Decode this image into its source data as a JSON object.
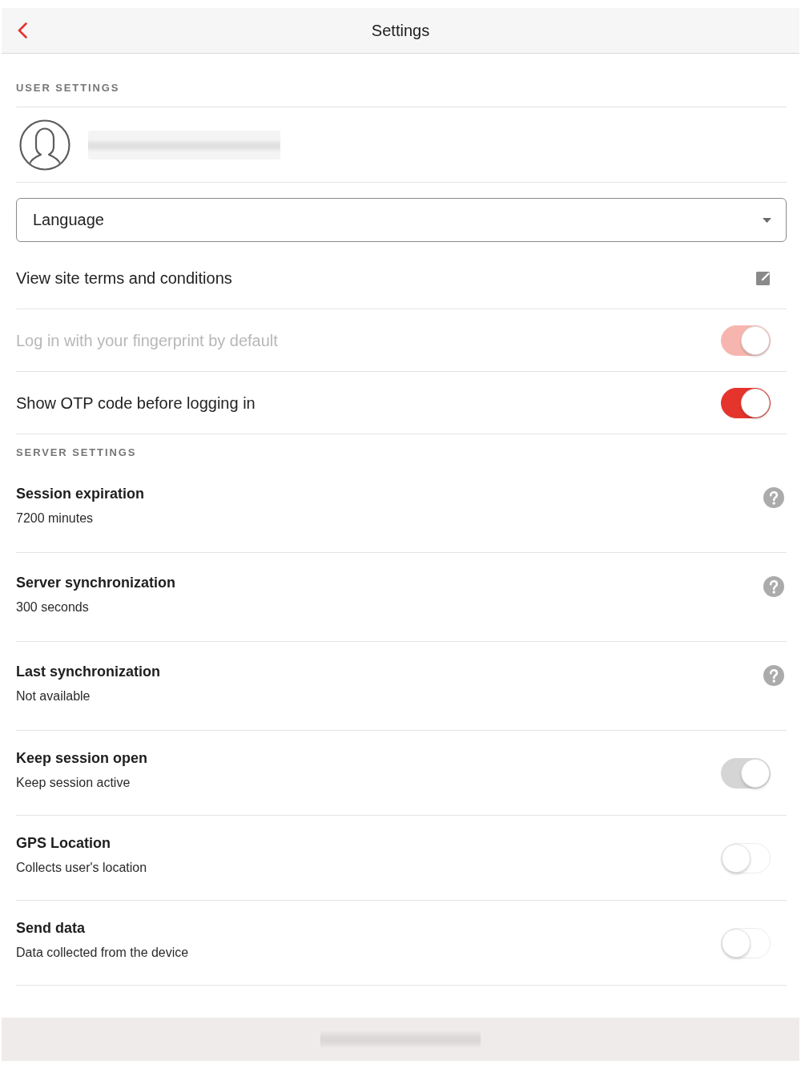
{
  "header": {
    "title": "Settings"
  },
  "user_settings": {
    "heading": "USER SETTINGS",
    "language_select": {
      "label": "Language"
    },
    "rows": [
      {
        "kind": "link",
        "label": "View site terms and conditions",
        "disabled": false
      },
      {
        "kind": "toggle",
        "label": "Log in with your fingerprint by default",
        "on": true,
        "disabled": true
      },
      {
        "kind": "toggle",
        "label": "Show OTP code before logging in",
        "on": true,
        "disabled": false
      }
    ]
  },
  "server_settings": {
    "heading": "SERVER SETTINGS",
    "items": [
      {
        "kind": "info",
        "title": "Session expiration",
        "subtitle": "7200 minutes",
        "disabled": false
      },
      {
        "kind": "info",
        "title": "Server synchronization",
        "subtitle": "300 seconds",
        "disabled": false
      },
      {
        "kind": "info",
        "title": "Last synchronization",
        "subtitle": "Not available",
        "disabled": false
      },
      {
        "kind": "toggle",
        "title": "Keep session open",
        "subtitle": "Keep session active",
        "on": true,
        "disabled": true
      },
      {
        "kind": "toggle",
        "title": "GPS Location",
        "subtitle": "Collects user's location",
        "on": false,
        "disabled": false
      },
      {
        "kind": "toggle",
        "title": "Send data",
        "subtitle": "Data collected from the device",
        "on": false,
        "disabled": false
      }
    ]
  }
}
